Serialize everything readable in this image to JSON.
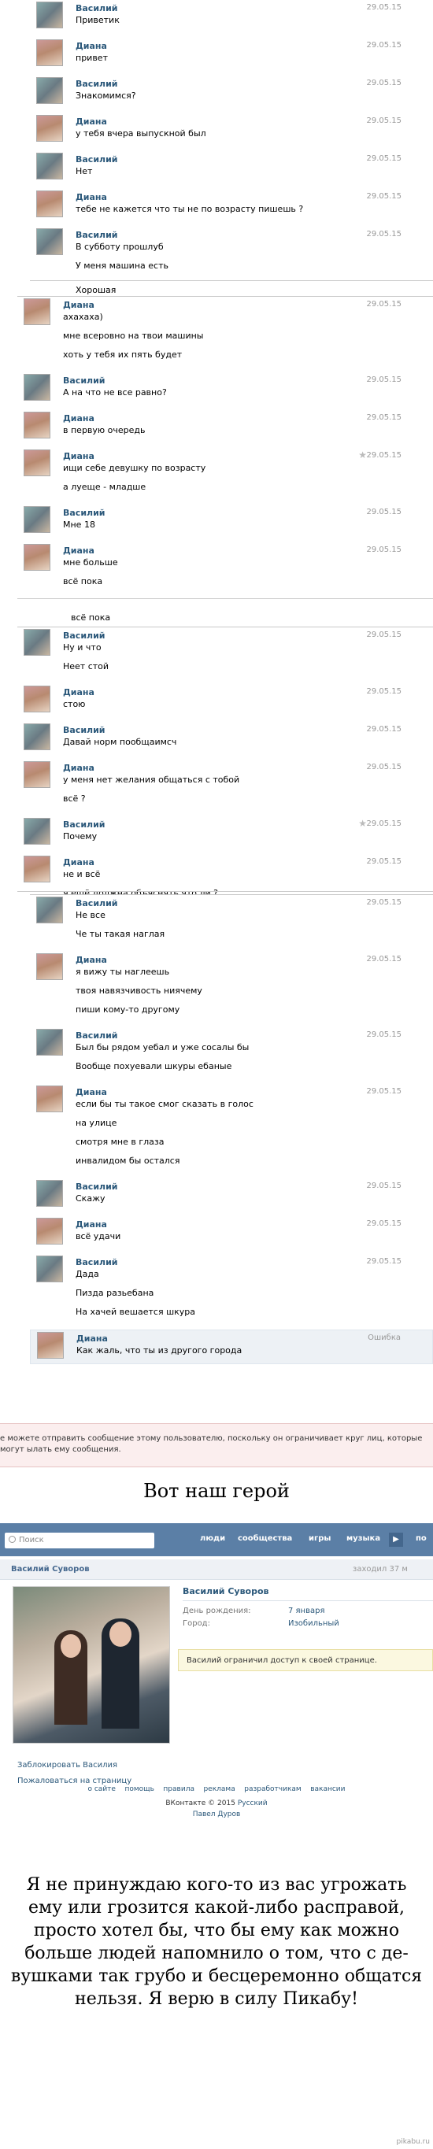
{
  "chat": {
    "block1": [
      {
        "name": "Василий",
        "date": "29.05.15",
        "text": "Приветик",
        "gender": "m"
      },
      {
        "name": "Диана",
        "date": "29.05.15",
        "text": "привет",
        "gender": "f"
      },
      {
        "name": "Василий",
        "date": "29.05.15",
        "text": "Знакомимся?",
        "gender": "m"
      },
      {
        "name": "Диана",
        "date": "29.05.15",
        "text": "у тебя вчера выпускной был",
        "gender": "f"
      },
      {
        "name": "Василий",
        "date": "29.05.15",
        "text": "Нет",
        "gender": "m"
      },
      {
        "name": "Диана",
        "date": "29.05.15",
        "text": "тебе не кажется что ты не по возрасту пишешь ?",
        "gender": "f"
      },
      {
        "name": "Василий",
        "date": "29.05.15",
        "text": "В субботу прошлуб",
        "text2": "У меня машина есть",
        "gender": "m"
      }
    ],
    "block2_top": "Хорошая",
    "block2": [
      {
        "name": "Диана",
        "date": "29.05.15",
        "text": "ахахаха)",
        "text2": "мне всеровно на твои машины",
        "text3": "хоть у тебя их пять будет",
        "gender": "f"
      },
      {
        "name": "Василий",
        "date": "29.05.15",
        "text": "А на что не все равно?",
        "gender": "m"
      },
      {
        "name": "Диана",
        "date": "29.05.15",
        "text": "в первую очередь",
        "gender": "f"
      },
      {
        "name": "Диана",
        "date": "29.05.15",
        "text": "ищи себе девушку по возрасту",
        "text2": "а луеще - младше",
        "gender": "f",
        "star": true
      },
      {
        "name": "Василий",
        "date": "29.05.15",
        "text": "Мне 18",
        "gender": "m"
      },
      {
        "name": "Диана",
        "date": "29.05.15",
        "text": "мне больше",
        "text2": "всё пока",
        "gender": "f"
      }
    ],
    "block3_top": "всё пока",
    "block3": [
      {
        "name": "Василий",
        "date": "29.05.15",
        "text": "Ну и что",
        "text2": "Неет стой",
        "gender": "m"
      },
      {
        "name": "Диана",
        "date": "29.05.15",
        "text": "стою",
        "gender": "f"
      },
      {
        "name": "Василий",
        "date": "29.05.15",
        "text": "Давай норм пообщаимсч",
        "gender": "m"
      },
      {
        "name": "Диана",
        "date": "29.05.15",
        "text": "у меня нет желания общаться с тобой",
        "text2": "всё ?",
        "gender": "f"
      },
      {
        "name": "Василий",
        "date": "29.05.15",
        "text": "Почему",
        "gender": "m",
        "star": true
      },
      {
        "name": "Диана",
        "date": "29.05.15",
        "text": "не и всё",
        "text2": "я ещё должна объяснять что ли ?",
        "gender": "f"
      }
    ],
    "block4_top": "я ещё должна объяснять что ли ?",
    "block4": [
      {
        "name": "Василий",
        "date": "29.05.15",
        "text": "Не все",
        "text2": "Че ты такая наглая",
        "gender": "m"
      },
      {
        "name": "Диана",
        "date": "29.05.15",
        "text": "я вижу ты наглеешь",
        "text2": "твоя навязчивость ниячему",
        "text3": "пиши кому-то другому",
        "gender": "f"
      },
      {
        "name": "Василий",
        "date": "29.05.15",
        "text": "Был бы рядом уебал и уже сосалы бы",
        "text2": "Вообще похуевали шкуры ебаные",
        "gender": "m"
      },
      {
        "name": "Диана",
        "date": "29.05.15",
        "text": "если бы ты такое смог сказать в голос",
        "text2": "на улице",
        "text3": "смотря мне в глаза",
        "text4": "инвалидом бы остался",
        "gender": "f"
      },
      {
        "name": "Василий",
        "date": "29.05.15",
        "text": "Скажу",
        "gender": "m"
      },
      {
        "name": "Диана",
        "date": "29.05.15",
        "text": "всё удачи",
        "gender": "f"
      },
      {
        "name": "Василий",
        "date": "29.05.15",
        "text": "Дада",
        "text2": "Пизда разьебана",
        "text3": "На хачей вешается шкура",
        "gender": "m"
      },
      {
        "name": "Диана",
        "date": "Ошибка",
        "text": "Как жаль, что ты из другого города",
        "gender": "f",
        "error": true
      }
    ]
  },
  "notice": "е можете отправить сообщение этому пользователю, поскольку он ограничивает круг лиц, которые могут ылать ему сообщения.",
  "heading": "Вот наш герой",
  "vk": {
    "search_placeholder": "Поиск",
    "nav": [
      "люди",
      "сообщества",
      "игры",
      "музыка",
      "по"
    ],
    "page_name": "Василий Суворов",
    "status": "заходил 37 м",
    "profile_name": "Василий Суворов",
    "birthday_label": "День рождения:",
    "birthday_value": "7 января",
    "city_label": "Город:",
    "city_value": "Изобильный",
    "restricted": "Василий ограничил доступ к своей странице.",
    "block_link": "Заблокировать Василия",
    "report_link": "Пожаловаться на страницу",
    "footer_links": [
      "о сайте",
      "помощь",
      "правила",
      "реклама",
      "разработчикам",
      "вакансии"
    ],
    "copyright": "ВКонтакте © 2015",
    "language": "Русский",
    "author": "Павел Дуров"
  },
  "closing": "Я не принуждаю кого-то из вас угрожать ему или грозится какой-либо расправой, просто хотел бы, что бы ему как можно больше людей напомнило о том, что с де- вушками так грубо и бесцеремонно общатся нельзя. Я верю в силу Пикабу!",
  "watermark": "pikabu.ru",
  "colors": {
    "link": "#2b587a",
    "vk_header": "#5b7fa6",
    "notice_bg": "#fbeeee"
  }
}
